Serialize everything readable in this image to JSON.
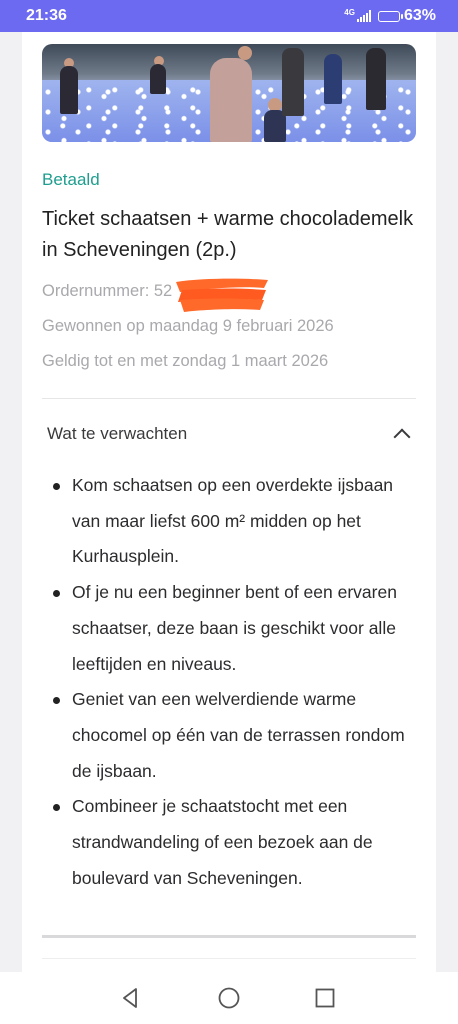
{
  "status_bar": {
    "time": "21:36",
    "network": "4G",
    "battery": "63%",
    "battery_level": 0.63,
    "bg_color": "#6d6af2",
    "icons": [
      "signal-icon",
      "battery-icon"
    ]
  },
  "order": {
    "status": "Betaald",
    "status_color": "#1f9e8f",
    "title": "Ticket schaatsen + warme chocolademelk in Scheveningen (2p.)",
    "order_number": "Ordernummer: 52",
    "won_on": "Gewonnen op maandag 9 februari 2026",
    "valid_until": "Geldig tot en met zondag 1 maart 2026"
  },
  "expect_section": {
    "title": "Wat te verwachten",
    "icon": "chevron-up-icon",
    "points": [
      "Kom schaatsen op een overdekte ijsbaan van maar liefst 600 m² midden op het Kurhausplein.",
      "Of je nu een beginner bent of een ervaren schaatser, deze baan is geschikt voor alle leeftijden en niveaus.",
      "Geniet van een welverdiende warme chocomel op één van de terrassen rondom de ijsbaan.",
      "Combineer je schaatstocht met een strandwandeling of een bezoek aan de boulevard van Scheveningen."
    ]
  },
  "nav_bar": {
    "icons": [
      "back-icon",
      "home-icon",
      "recents-icon"
    ]
  }
}
